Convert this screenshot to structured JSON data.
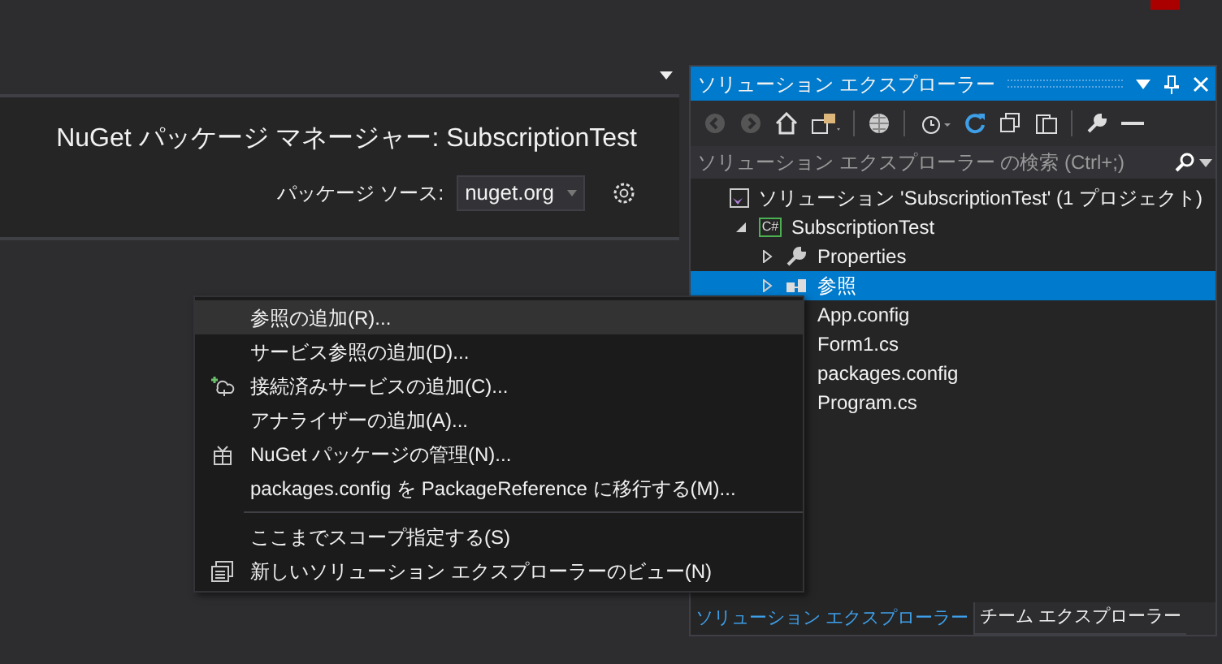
{
  "nuget": {
    "title": "NuGet パッケージ マネージャー: SubscriptionTest",
    "source_label": "パッケージ ソース:",
    "source_value": "nuget.org"
  },
  "solution_explorer": {
    "title": "ソリューション エクスプローラー",
    "search": {
      "placeholder": "ソリューション エクスプローラー の検索 (Ctrl+;)"
    },
    "tree": [
      {
        "label": "ソリューション 'SubscriptionTest' (1 プロジェクト)",
        "kind": "solution",
        "selected": false,
        "children": [
          {
            "label": "SubscriptionTest",
            "kind": "project",
            "icon_text": "C#",
            "expanded": true,
            "selected": false,
            "children": [
              {
                "label": "Properties",
                "kind": "properties",
                "expanded": false,
                "selected": false
              },
              {
                "label": "参照",
                "kind": "references",
                "expanded": false,
                "selected": true
              },
              {
                "label": "App.config",
                "kind": "file",
                "selected": false
              },
              {
                "label": "Form1.cs",
                "kind": "file",
                "selected": false
              },
              {
                "label": "packages.config",
                "kind": "file",
                "selected": false
              },
              {
                "label": "Program.cs",
                "kind": "file",
                "selected": false
              }
            ]
          }
        ]
      }
    ],
    "tabs": [
      {
        "label": "ソリューション エクスプローラー",
        "selected": true
      },
      {
        "label": "チーム エクスプローラー",
        "selected": false
      }
    ]
  },
  "context_menu": [
    {
      "kind": "plain",
      "label": "参照の追加(R)...",
      "selected": true
    },
    {
      "kind": "plain",
      "label": "サービス参照の追加(D)...",
      "selected": false
    },
    {
      "kind": "connected-service",
      "label": "接続済みサービスの追加(C)...",
      "selected": false
    },
    {
      "kind": "plain",
      "label": "アナライザーの追加(A)...",
      "selected": false
    },
    {
      "kind": "nuget",
      "label": "NuGet パッケージの管理(N)...",
      "selected": false
    },
    {
      "kind": "plain",
      "label": "packages.config を PackageReference に移行する(M)...",
      "selected": false
    },
    {
      "kind": "separator"
    },
    {
      "kind": "plain",
      "label": "ここまでスコープ指定する(S)",
      "selected": false
    },
    {
      "kind": "view",
      "label": "新しいソリューション エクスプローラーのビュー(N)",
      "selected": false
    }
  ]
}
